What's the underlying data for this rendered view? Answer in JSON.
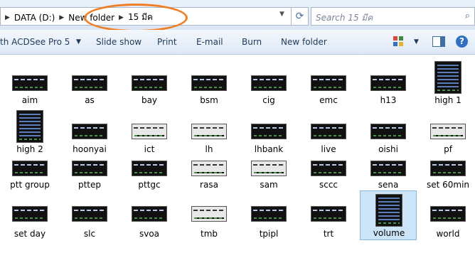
{
  "address": {
    "crumbs": [
      "DATA (D:)",
      "New folder",
      "15 มีค"
    ]
  },
  "search": {
    "placeholder": "Search 15 มีค"
  },
  "toolbar": {
    "open_with": "th ACDSee Pro 5",
    "slide_show": "Slide show",
    "print": "Print",
    "email": "E-mail",
    "burn": "Burn",
    "new_folder": "New folder"
  },
  "files": [
    {
      "name": "aim"
    },
    {
      "name": "as"
    },
    {
      "name": "bay"
    },
    {
      "name": "bsm"
    },
    {
      "name": "cig"
    },
    {
      "name": "emc"
    },
    {
      "name": "h13"
    },
    {
      "name": "high 1"
    },
    {
      "name": "high 2"
    },
    {
      "name": "hoonyai"
    },
    {
      "name": "ict"
    },
    {
      "name": "lh"
    },
    {
      "name": "lhbank"
    },
    {
      "name": "live"
    },
    {
      "name": "oishi"
    },
    {
      "name": "pf"
    },
    {
      "name": "ptt group"
    },
    {
      "name": "pttep"
    },
    {
      "name": "pttgc"
    },
    {
      "name": "rasa"
    },
    {
      "name": "sam"
    },
    {
      "name": "sccc"
    },
    {
      "name": "sena"
    },
    {
      "name": "set 60min"
    },
    {
      "name": "set day"
    },
    {
      "name": "slc"
    },
    {
      "name": "svoa"
    },
    {
      "name": "tmb"
    },
    {
      "name": "tpipl"
    },
    {
      "name": "trt"
    },
    {
      "name": "volume",
      "selected": true
    },
    {
      "name": "world"
    }
  ],
  "colors": {
    "annotation_circle": "#f07d22",
    "selection": "#cce4f7"
  }
}
